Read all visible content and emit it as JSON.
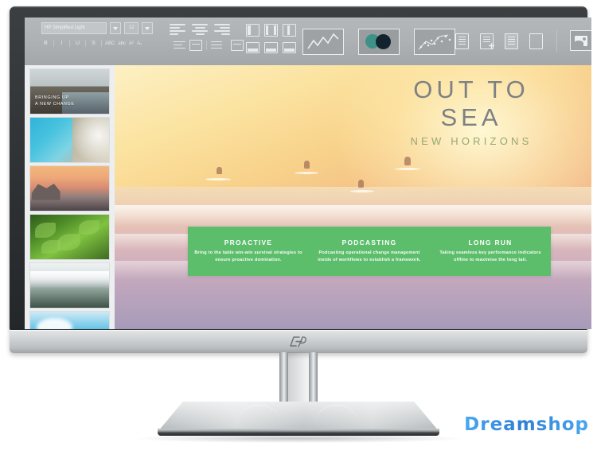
{
  "product": {
    "brand_logo": "hp-logo",
    "watermark": "Dreamshop"
  },
  "toolbar": {
    "font_name": "HP Simplified Light",
    "font_size": "12",
    "font_name_dropdown": "chevron-down-icon",
    "font_size_dropdown": "chevron-down-icon",
    "bold": "B",
    "italic": "I",
    "underline": "U",
    "strikethrough": "S",
    "spellcheck": "ABC",
    "spellcheck_off": "abc",
    "superscript": "A²",
    "subscript": "A₂",
    "align_left": "align-left-icon",
    "align_center": "align-center-icon",
    "align_right": "align-right-icon",
    "indent_decrease": "indent-decrease-icon",
    "line_spacing": "line-spacing-icon",
    "indent_increase": "indent-increase-icon",
    "text_box": "text-box-icon",
    "layout_one": "layout-single-icon",
    "layout_two": "layout-two-icon",
    "layout_three": "layout-three-icon",
    "layout_caption_a": "layout-caption-a-icon",
    "layout_caption_b": "layout-caption-b-icon",
    "layout_caption_c": "layout-caption-c-icon",
    "chart_line": "line-chart-icon",
    "chart_circles": "circles-icon",
    "chart_scatter": "scatter-chart-icon",
    "doc_notes": "document-notes-icon",
    "doc_add": "document-add-icon",
    "doc_text": "document-text-icon",
    "doc_blank": "document-blank-icon",
    "insert_image": "image-icon",
    "accent_teal": "#3d9188",
    "accent_dark": "#13232e"
  },
  "thumbnails": [
    {
      "caption_line1": "BRINGING UP",
      "caption_line2": "A NEW CHANGE",
      "art": "coastal-cliff"
    },
    {
      "caption_line1": "",
      "caption_line2": "",
      "art": "turquoise-reef"
    },
    {
      "caption_line1": "",
      "caption_line2": "",
      "art": "beach-sunset"
    },
    {
      "caption_line1": "",
      "caption_line2": "",
      "art": "green-leaves"
    },
    {
      "caption_line1": "",
      "caption_line2": "",
      "art": "misty-coast"
    },
    {
      "caption_line1": "",
      "caption_line2": "",
      "art": "blue-sky"
    }
  ],
  "slide": {
    "title_line1": "OUT TO",
    "title_line2": "SEA",
    "subtitle": "NEW HORIZONS",
    "title_color": "#7e8184",
    "subtitle_color": "#96a872",
    "banner_color": "#5cbe6b",
    "columns": [
      {
        "heading": "PROACTIVE",
        "body": "Bring to the table win-win survival strategies to ensure proactive domination."
      },
      {
        "heading": "PODCASTING",
        "body": "Podcasting operational change management inside of workflows to establish a framework."
      },
      {
        "heading": "LONG RUN",
        "body": "Taking seamless key performance indicators offline to maximise the long tail."
      }
    ]
  }
}
